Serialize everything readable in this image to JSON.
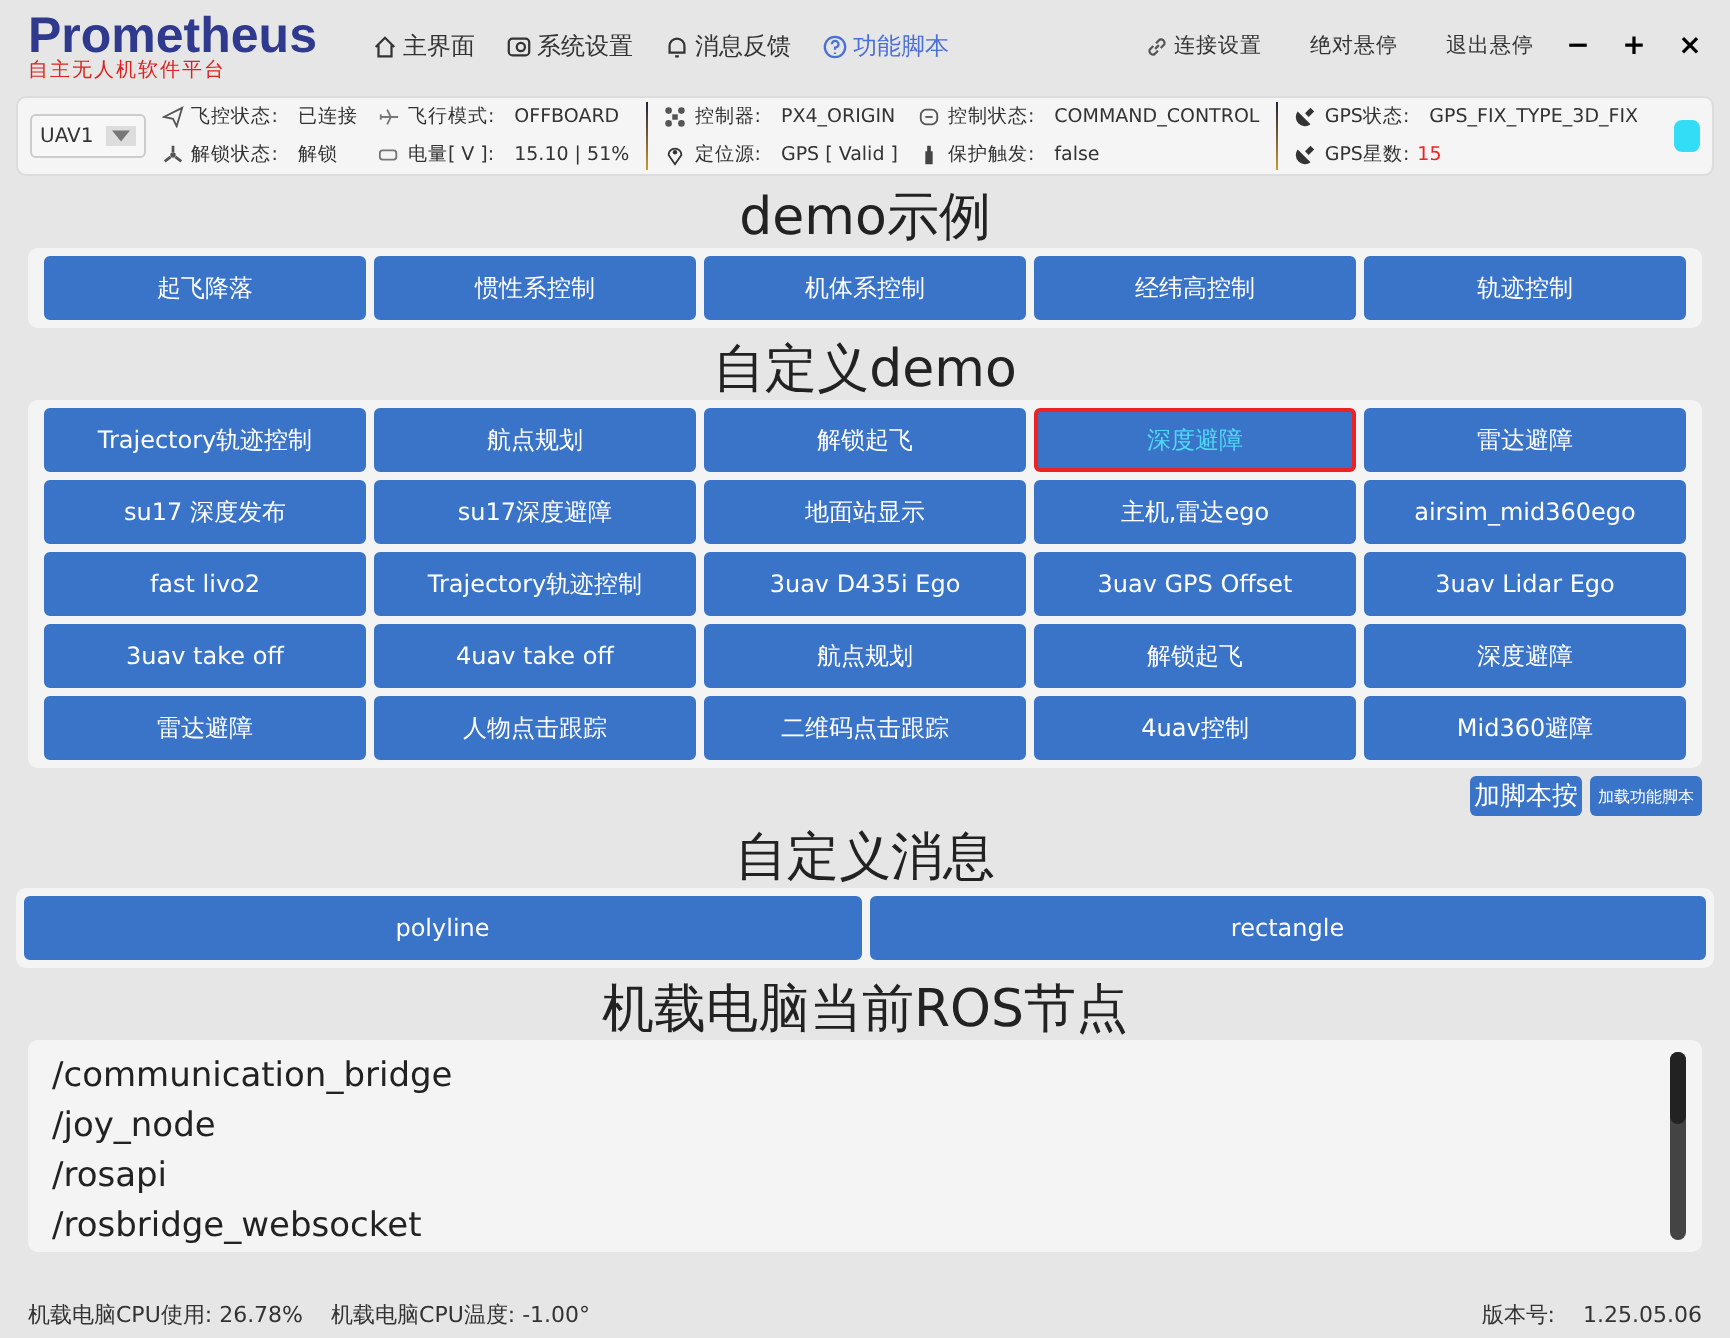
{
  "logo": {
    "title": "Prometheus",
    "subtitle": "自主无人机软件平台"
  },
  "nav": [
    {
      "label": "主界面",
      "selected": false
    },
    {
      "label": "系统设置",
      "selected": false
    },
    {
      "label": "消息反馈",
      "selected": false
    },
    {
      "label": "功能脚本",
      "selected": true
    }
  ],
  "top_actions": [
    "连接设置",
    "绝对悬停",
    "退出悬停"
  ],
  "window_controls": [
    "−",
    "+",
    "×"
  ],
  "status": {
    "uav_select": "UAV1",
    "groups": [
      [
        {
          "label": "飞控状态:",
          "value": "已连接",
          "alert": false
        },
        {
          "label": "解锁状态:",
          "value": "解锁",
          "alert": false
        },
        {
          "label": "飞行模式:",
          "value": "OFFBOARD",
          "alert": false
        },
        {
          "label": "电量[ V ]:",
          "value": "15.10 | 51%",
          "alert": false
        }
      ],
      [
        {
          "label": "控制器:",
          "value": "PX4_ORIGIN",
          "alert": false
        },
        {
          "label": "定位源:",
          "value": "GPS [ Valid ]",
          "alert": false
        },
        {
          "label": "控制状态:",
          "value": "COMMAND_CONTROL",
          "alert": false
        },
        {
          "label": "保护触发:",
          "value": "false",
          "alert": false
        }
      ],
      [
        {
          "label": "GPS状态:",
          "value": "GPS_FIX_TYPE_3D_FIX",
          "alert": false
        },
        {
          "label": "GPS星数:",
          "value": "15",
          "alert": true
        }
      ]
    ]
  },
  "sections": [
    {
      "title": "demo示例",
      "buttons": [
        {
          "label": "起飞降落",
          "selected": false
        },
        {
          "label": "惯性系控制",
          "selected": false
        },
        {
          "label": "机体系控制",
          "selected": false
        },
        {
          "label": "经纬高控制",
          "selected": false
        },
        {
          "label": "轨迹控制",
          "selected": false
        }
      ]
    },
    {
      "title": "自定义demo",
      "buttons": [
        {
          "label": "Trajectory轨迹控制",
          "selected": false
        },
        {
          "label": "航点规划",
          "selected": false
        },
        {
          "label": "解锁起飞",
          "selected": false
        },
        {
          "label": "深度避障",
          "selected": true
        },
        {
          "label": "雷达避障",
          "selected": false
        },
        {
          "label": "su17 深度发布",
          "selected": false
        },
        {
          "label": "su17深度避障",
          "selected": false
        },
        {
          "label": "地面站显示",
          "selected": false
        },
        {
          "label": "主机,雷达ego",
          "selected": false
        },
        {
          "label": "airsim_mid360ego",
          "selected": false
        },
        {
          "label": "fast livo2",
          "selected": false
        },
        {
          "label": "Trajectory轨迹控制",
          "selected": false
        },
        {
          "label": "3uav D435i Ego",
          "selected": false
        },
        {
          "label": "3uav GPS Offset",
          "selected": false
        },
        {
          "label": "3uav Lidar Ego",
          "selected": false
        },
        {
          "label": "3uav take off",
          "selected": false
        },
        {
          "label": "4uav take off",
          "selected": false
        },
        {
          "label": "航点规划",
          "selected": false
        },
        {
          "label": "解锁起飞",
          "selected": false
        },
        {
          "label": "深度避障",
          "selected": false
        },
        {
          "label": "雷达避障",
          "selected": false
        },
        {
          "label": "人物点击跟踪",
          "selected": false
        },
        {
          "label": "二维码点击跟踪",
          "selected": false
        },
        {
          "label": "4uav控制",
          "selected": false
        },
        {
          "label": "Mid360避障",
          "selected": false
        }
      ]
    }
  ],
  "script_buttons": [
    "加脚本按",
    "加载功能脚本"
  ],
  "messages": {
    "title": "自定义消息",
    "buttons": [
      "polyline",
      "rectangle"
    ]
  },
  "ros_nodes": {
    "title": "机载电脑当前ROS节点",
    "items": [
      "/communication_bridge",
      "/joy_node",
      "/rosapi",
      "/rosbridge_websocket"
    ]
  },
  "status_bar": {
    "cpu_usage": "机载电脑CPU使用: 26.78%",
    "cpu_temp": "机载电脑CPU温度: -1.00°",
    "version_label": "版本号:",
    "version": "1.25.05.06"
  }
}
